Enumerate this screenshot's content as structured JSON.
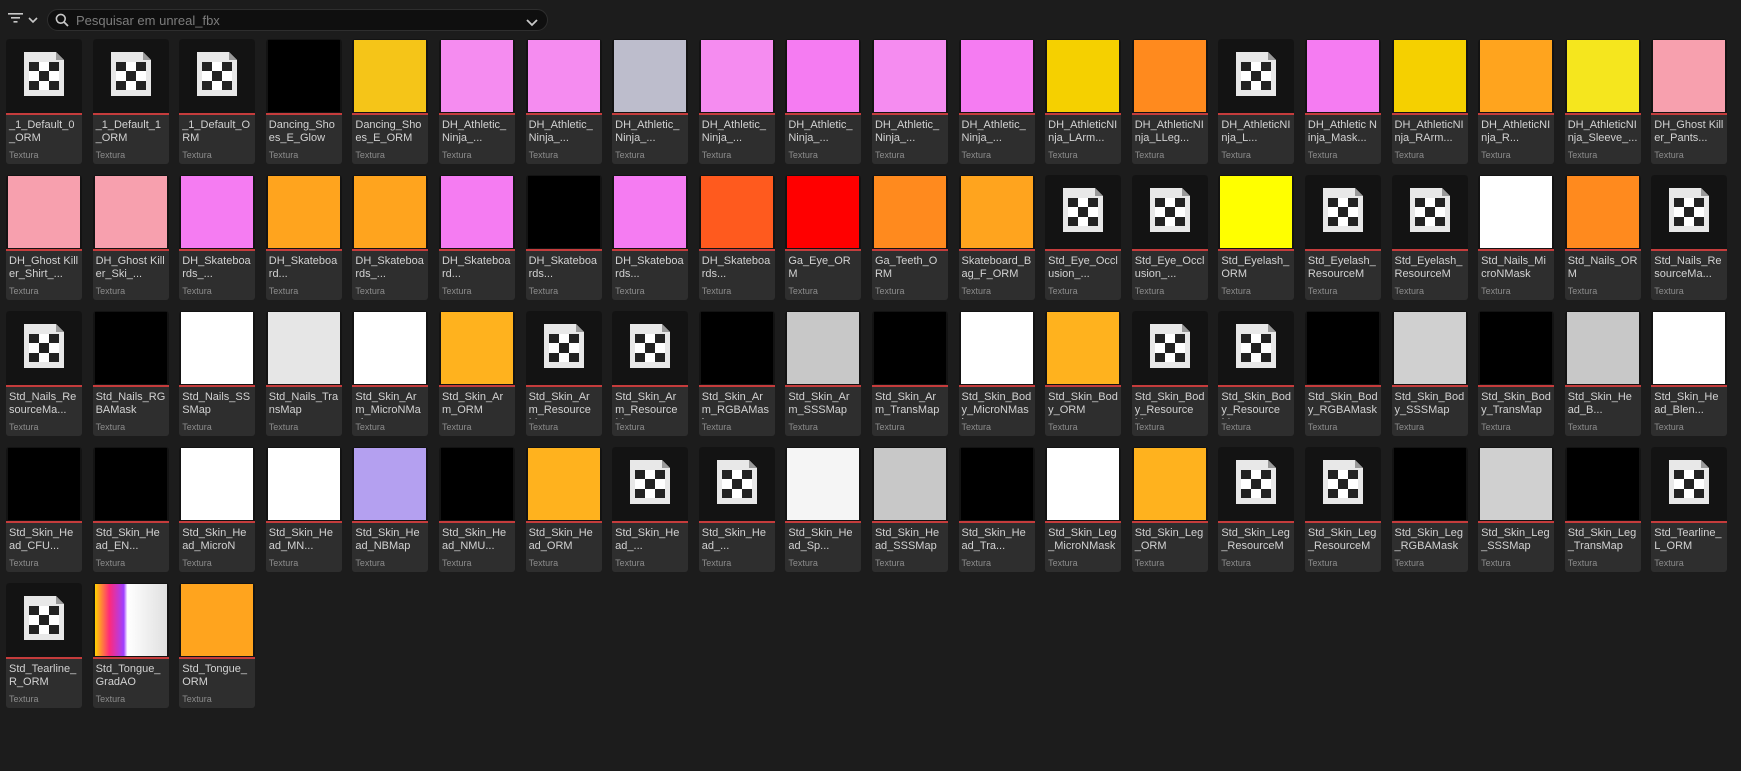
{
  "toolbar": {
    "search_placeholder": "Pesquisar em unreal_fbx"
  },
  "colors": {
    "background": "#1c1c1c",
    "tile": "#2e2e2e",
    "accent_line": "#c53c3c"
  },
  "assets": [
    {
      "name": "_1_Default_0_ORM",
      "type": "Textura",
      "thumb": "checker-icon"
    },
    {
      "name": "_1_Default_1_ORM",
      "type": "Textura",
      "thumb": "checker-icon"
    },
    {
      "name": "_1_Default_ORM",
      "type": "Textura",
      "thumb": "checker-icon"
    },
    {
      "name": "Dancing_Shoes_E_Glow",
      "type": "Textura",
      "thumb": "#000000"
    },
    {
      "name": "Dancing_Shoes_E_ORM",
      "type": "Textura",
      "thumb": "#f5c518"
    },
    {
      "name": "DH_Athletic_Ninja_...",
      "type": "Textura",
      "thumb": "#f58cf0"
    },
    {
      "name": "DH_Athletic_Ninja_...",
      "type": "Textura",
      "thumb": "#f58cf0"
    },
    {
      "name": "DH_Athletic_Ninja_...",
      "type": "Textura",
      "thumb": "#bdbdcc"
    },
    {
      "name": "DH_Athletic_Ninja_...",
      "type": "Textura",
      "thumb": "#f58cf0"
    },
    {
      "name": "DH_Athletic_Ninja_...",
      "type": "Textura",
      "thumb": "#f57cf2"
    },
    {
      "name": "DH_Athletic_Ninja_...",
      "type": "Textura",
      "thumb": "#f58cf0"
    },
    {
      "name": "DH_Athletic_Ninja_...",
      "type": "Textura",
      "thumb": "#f57cf2"
    },
    {
      "name": "DH_AthleticNInja_LArm...",
      "type": "Textura",
      "thumb": "#f5d000"
    },
    {
      "name": "DH_AthleticNInja_LLeg...",
      "type": "Textura",
      "thumb": "#ff8a1e"
    },
    {
      "name": "DH_AthleticNInja_L...",
      "type": "Textura",
      "thumb": "checker-icon"
    },
    {
      "name": "DH_Athletic Ninja_Mask...",
      "type": "Textura",
      "thumb": "#f57cf2"
    },
    {
      "name": "DH_AthleticNInja_RArm...",
      "type": "Textura",
      "thumb": "#f5d000"
    },
    {
      "name": "DH_AthleticNInja_R...",
      "type": "Textura",
      "thumb": "#ffa41e"
    },
    {
      "name": "DH_AthleticNInja_Sleeve_...",
      "type": "Textura",
      "thumb": "#f5e61e"
    },
    {
      "name": "DH_Ghost Killer_Pants...",
      "type": "Textura",
      "thumb": "#f7a0ae"
    },
    {
      "name": "DH_Ghost Killer_Shirt_...",
      "type": "Textura",
      "thumb": "#f7a0ae"
    },
    {
      "name": "DH_Ghost Killer_Ski_...",
      "type": "Textura",
      "thumb": "#f7a0ae"
    },
    {
      "name": "DH_Skateboards_...",
      "type": "Textura",
      "thumb": "#f57cf2"
    },
    {
      "name": "DH_Skateboard...",
      "type": "Textura",
      "thumb": "#ffa41e"
    },
    {
      "name": "DH_Skateboards_...",
      "type": "Textura",
      "thumb": "#ffa41e"
    },
    {
      "name": "DH_Skateboard...",
      "type": "Textura",
      "thumb": "#f57cf2"
    },
    {
      "name": "DH_Skateboards...",
      "type": "Textura",
      "thumb": "#000000"
    },
    {
      "name": "DH_Skateboards...",
      "type": "Textura",
      "thumb": "#f57cf2"
    },
    {
      "name": "DH_Skateboards...",
      "type": "Textura",
      "thumb": "#ff5a1e"
    },
    {
      "name": "Ga_Eye_ORM",
      "type": "Textura",
      "thumb": "#ff0000"
    },
    {
      "name": "Ga_Teeth_ORM",
      "type": "Textura",
      "thumb": "#ff8a1e"
    },
    {
      "name": "Skateboard_Bag_F_ORM",
      "type": "Textura",
      "thumb": "#ffa41e"
    },
    {
      "name": "Std_Eye_Occlusion_...",
      "type": "Textura",
      "thumb": "checker-icon"
    },
    {
      "name": "Std_Eye_Occlusion_...",
      "type": "Textura",
      "thumb": "checker-icon"
    },
    {
      "name": "Std_Eyelash_ORM",
      "type": "Textura",
      "thumb": "#ffff00"
    },
    {
      "name": "Std_Eyelash_ResourceMa...",
      "type": "Textura",
      "thumb": "checker-icon"
    },
    {
      "name": "Std_Eyelash_ResourceMa...",
      "type": "Textura",
      "thumb": "checker-icon"
    },
    {
      "name": "Std_Nails_MicroNMask",
      "type": "Textura",
      "thumb": "#ffffff"
    },
    {
      "name": "Std_Nails_ORM",
      "type": "Textura",
      "thumb": "#ff8a1e"
    },
    {
      "name": "Std_Nails_ResourceMa...",
      "type": "Textura",
      "thumb": "checker-icon"
    },
    {
      "name": "Std_Nails_ResourceMa...",
      "type": "Textura",
      "thumb": "checker-icon"
    },
    {
      "name": "Std_Nails_RGBAMask",
      "type": "Textura",
      "thumb": "#000000"
    },
    {
      "name": "Std_Nails_SSSMap",
      "type": "Textura",
      "thumb": "#ffffff"
    },
    {
      "name": "Std_Nails_TransMap",
      "type": "Textura",
      "thumb": "#e6e6e6"
    },
    {
      "name": "Std_Skin_Arm_MicroNMask",
      "type": "Textura",
      "thumb": "#ffffff"
    },
    {
      "name": "Std_Skin_Arm_ORM",
      "type": "Textura",
      "thumb": "#ffb21e"
    },
    {
      "name": "Std_Skin_Arm_ResourceM...",
      "type": "Textura",
      "thumb": "checker-icon"
    },
    {
      "name": "Std_Skin_Arm_ResourceM...",
      "type": "Textura",
      "thumb": "checker-icon"
    },
    {
      "name": "Std_Skin_Arm_RGBAMask",
      "type": "Textura",
      "thumb": "#000000"
    },
    {
      "name": "Std_Skin_Arm_SSSMap",
      "type": "Textura",
      "thumb": "#c8c8c8"
    },
    {
      "name": "Std_Skin_Arm_TransMap",
      "type": "Textura",
      "thumb": "#000000"
    },
    {
      "name": "Std_Skin_Body_MicroNMask",
      "type": "Textura",
      "thumb": "#ffffff"
    },
    {
      "name": "Std_Skin_Body_ORM",
      "type": "Textura",
      "thumb": "#ffb21e"
    },
    {
      "name": "Std_Skin_Body_ResourceM...",
      "type": "Textura",
      "thumb": "checker-icon"
    },
    {
      "name": "Std_Skin_Body_ResourceM...",
      "type": "Textura",
      "thumb": "checker-icon"
    },
    {
      "name": "Std_Skin_Body_RGBAMask",
      "type": "Textura",
      "thumb": "#000000"
    },
    {
      "name": "Std_Skin_Body_SSSMap",
      "type": "Textura",
      "thumb": "#d0d0d0"
    },
    {
      "name": "Std_Skin_Body_TransMap",
      "type": "Textura",
      "thumb": "#000000"
    },
    {
      "name": "Std_Skin_Head_B...",
      "type": "Textura",
      "thumb": "#c8c8c8"
    },
    {
      "name": "Std_Skin_Head_Blen...",
      "type": "Textura",
      "thumb": "#ffffff"
    },
    {
      "name": "Std_Skin_Head_CFU...",
      "type": "Textura",
      "thumb": "#000000"
    },
    {
      "name": "Std_Skin_Head_EN...",
      "type": "Textura",
      "thumb": "#000000"
    },
    {
      "name": "Std_Skin_Head_MicroN",
      "type": "Textura",
      "thumb": "#ffffff"
    },
    {
      "name": "Std_Skin_Head_MN...",
      "type": "Textura",
      "thumb": "#ffffff"
    },
    {
      "name": "Std_Skin_Head_NBMap",
      "type": "Textura",
      "thumb": "#b4a0f0"
    },
    {
      "name": "Std_Skin_Head_NMU...",
      "type": "Textura",
      "thumb": "#000000"
    },
    {
      "name": "Std_Skin_Head_ORM",
      "type": "Textura",
      "thumb": "#ffb21e"
    },
    {
      "name": "Std_Skin_Head_...",
      "type": "Textura",
      "thumb": "checker-icon"
    },
    {
      "name": "Std_Skin_Head_...",
      "type": "Textura",
      "thumb": "checker-icon"
    },
    {
      "name": "Std_Skin_Head_Sp...",
      "type": "Textura",
      "thumb": "#f5f5f5"
    },
    {
      "name": "Std_Skin_Head_SSSMap",
      "type": "Textura",
      "thumb": "#c8c8c8"
    },
    {
      "name": "Std_Skin_Head_Tra...",
      "type": "Textura",
      "thumb": "#000000"
    },
    {
      "name": "Std_Skin_Leg_MicroNMask",
      "type": "Textura",
      "thumb": "#ffffff"
    },
    {
      "name": "Std_Skin_Leg_ORM",
      "type": "Textura",
      "thumb": "#ffb21e"
    },
    {
      "name": "Std_Skin_Leg_ResourceMa...",
      "type": "Textura",
      "thumb": "checker-icon"
    },
    {
      "name": "Std_Skin_Leg_ResourceMa...",
      "type": "Textura",
      "thumb": "checker-icon"
    },
    {
      "name": "Std_Skin_Leg_RGBAMask",
      "type": "Textura",
      "thumb": "#000000"
    },
    {
      "name": "Std_Skin_Leg_SSSMap",
      "type": "Textura",
      "thumb": "#d0d0d0"
    },
    {
      "name": "Std_Skin_Leg_TransMap",
      "type": "Textura",
      "thumb": "#000000"
    },
    {
      "name": "Std_Tearline_L_ORM",
      "type": "Textura",
      "thumb": "checker-icon"
    },
    {
      "name": "Std_Tearline_R_ORM",
      "type": "Textura",
      "thumb": "checker-icon"
    },
    {
      "name": "Std_Tongue_GradAO",
      "type": "Textura",
      "thumb": "gradient"
    },
    {
      "name": "Std_Tongue_ORM",
      "type": "Textura",
      "thumb": "#ffa41e"
    }
  ]
}
